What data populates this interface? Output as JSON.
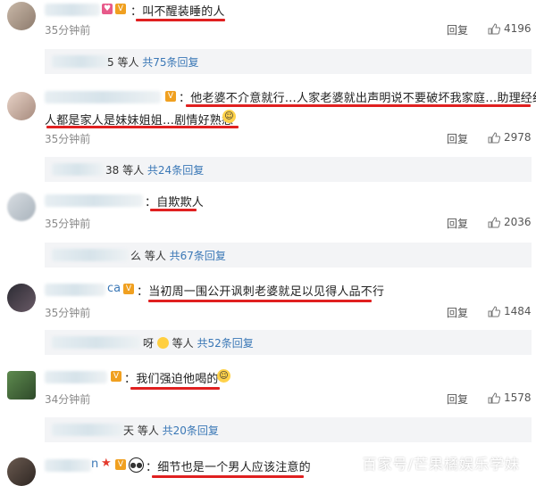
{
  "comments": [
    {
      "text": "：叫不醒装睡的人",
      "time": "35分钟前",
      "reply": "回复",
      "likes": "4196",
      "sub": {
        "suffix": "5 等人",
        "link": "共75条回复"
      }
    },
    {
      "text": "：他老婆不介意就行…人家老婆就出声明说不要破坏我家庭…助理经纪",
      "text2": "人都是家人是妹妹姐姐…剧情好熟悉",
      "time": "35分钟前",
      "reply": "回复",
      "likes": "2978",
      "sub": {
        "suffix": "38 等人",
        "link": "共24条回复"
      }
    },
    {
      "text": "：自欺欺人",
      "time": "35分钟前",
      "reply": "回复",
      "likes": "2036",
      "sub": {
        "suffix": "么 等人",
        "link": "共67条回复"
      }
    },
    {
      "name_tail": "ca",
      "text": "：当初周一围公开讽刺老婆就足以见得人品不行",
      "time": "35分钟前",
      "reply": "回复",
      "likes": "1484",
      "sub": {
        "suffix": "呀",
        "suffix2": "等人",
        "link": "共52条回复"
      }
    },
    {
      "text": "：我们强迫他喝的",
      "time": "34分钟前",
      "reply": "回复",
      "likes": "1578",
      "sub": {
        "suffix": "天 等人",
        "link": "共20条回复"
      }
    },
    {
      "name_tail": "n",
      "text": "：细节也是一个男人应该注意的"
    }
  ],
  "watermark": "百家号/芒果橘娱乐学妹",
  "colors": {
    "underline": "#e02020",
    "link": "#3b78b6"
  }
}
